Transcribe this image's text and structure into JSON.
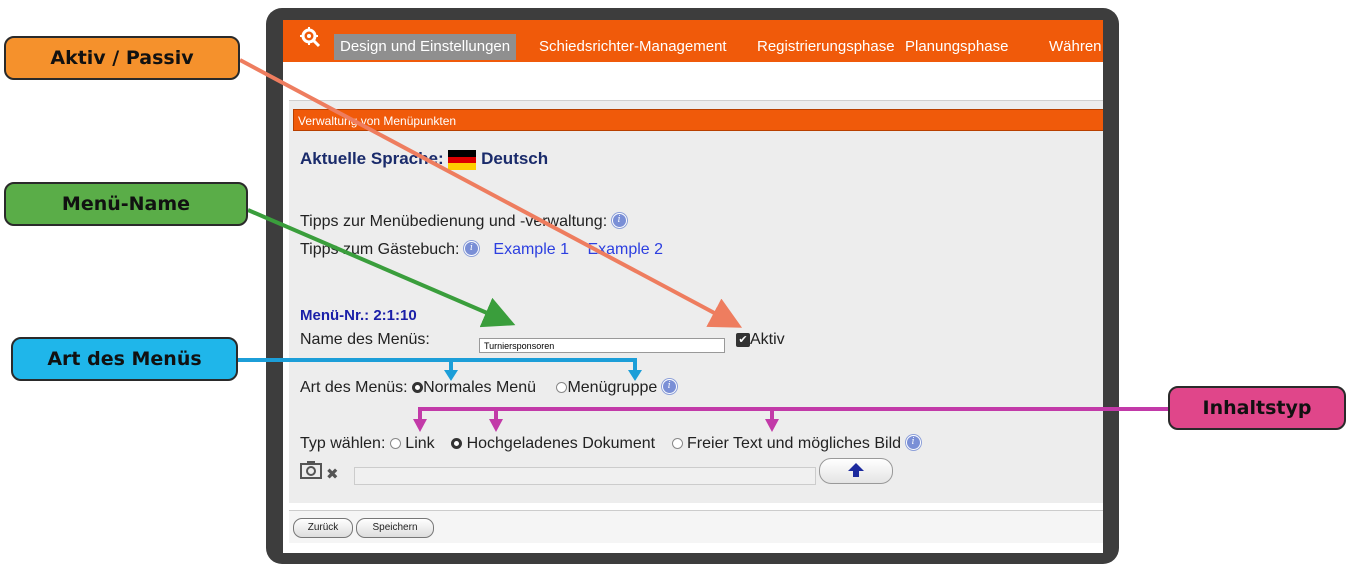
{
  "nav": {
    "tabs": [
      {
        "label": "Design und Einstellungen",
        "active": true
      },
      {
        "label": "Schiedsrichter-Management"
      },
      {
        "label": "Registrierungsphase"
      },
      {
        "label": "Planungsphase"
      },
      {
        "label": "Währen"
      }
    ]
  },
  "panel": {
    "header": "Verwaltung von Menüpunkten",
    "language_label": "Aktuelle Sprache:",
    "language_value": "Deutsch",
    "tips_menu": "Tipps zur Menübedienung und -verwaltung:",
    "tips_guestbook": "Tipps zum Gästebuch:",
    "example1": "Example 1",
    "example2": "Example 2",
    "menu_nr": "Menü-Nr.: 2:1:10",
    "name_label": "Name des Menüs:",
    "name_value": "Turniersponsoren",
    "active_label": "Aktiv",
    "active_checked": true,
    "type_label": "Art des Menüs:",
    "type_normal": "Normales Menü",
    "type_group": "Menügruppe",
    "content_label": "Typ wählen:",
    "content_link": "Link",
    "content_doc": "Hochgeladenes Dokument",
    "content_text": "Freier Text und mögliches Bild"
  },
  "footer": {
    "back": "Zurück",
    "save": "Speichern"
  },
  "callouts": {
    "aktiv": {
      "label": "Aktiv / Passiv",
      "color": "#f5912c"
    },
    "menuname": {
      "label": "Menü-Name",
      "color": "#5aad48"
    },
    "art": {
      "label": "Art des Menüs",
      "color": "#1fb6ea"
    },
    "inhalt": {
      "label": "Inhaltstyp",
      "color": "#e0468a"
    }
  },
  "colors": {
    "brand": "#f05a0a",
    "arrow_orange": "#ee7d5f",
    "arrow_green": "#3a9e3c",
    "arrow_blue": "#1c9ed8",
    "arrow_magenta": "#c23aa8"
  },
  "icons": [
    "gear-icon",
    "info-icon",
    "germany-flag-icon",
    "camera-icon",
    "remove-icon",
    "upload-arrow-icon",
    "checkbox-icon"
  ]
}
